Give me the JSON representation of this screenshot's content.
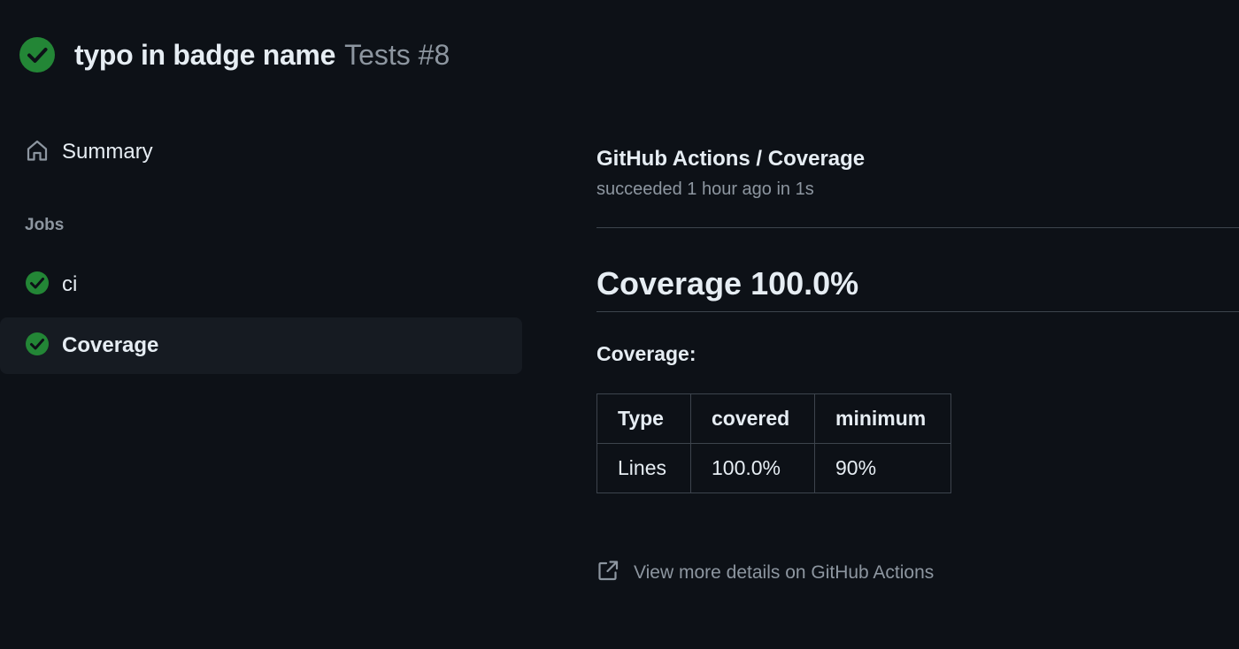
{
  "header": {
    "title": "typo in badge name",
    "subtitle": "Tests #8",
    "status_icon": "check-circle-fill-icon",
    "status_color": "#238636"
  },
  "sidebar": {
    "summary": {
      "label": "Summary",
      "icon": "home-icon"
    },
    "jobs_heading": "Jobs",
    "jobs": [
      {
        "label": "ci",
        "icon": "check-circle-fill-icon",
        "selected": false
      },
      {
        "label": "Coverage",
        "icon": "check-circle-fill-icon",
        "selected": true
      }
    ]
  },
  "main": {
    "check_title": "GitHub Actions / Coverage",
    "check_status": "succeeded 1 hour ago in 1s",
    "heading": "Coverage 100.0%",
    "subheading": "Coverage:",
    "table": {
      "headers": [
        "Type",
        "covered",
        "minimum"
      ],
      "rows": [
        [
          "Lines",
          "100.0%",
          "90%"
        ]
      ]
    },
    "details_link": {
      "label": "View more details on GitHub Actions",
      "icon": "link-external-icon"
    }
  },
  "colors": {
    "background": "#0d1117",
    "selected_background": "#161b22",
    "text": "#e6edf3",
    "muted_text": "#8d96a0",
    "border": "#3d444d",
    "success": "#238636"
  }
}
